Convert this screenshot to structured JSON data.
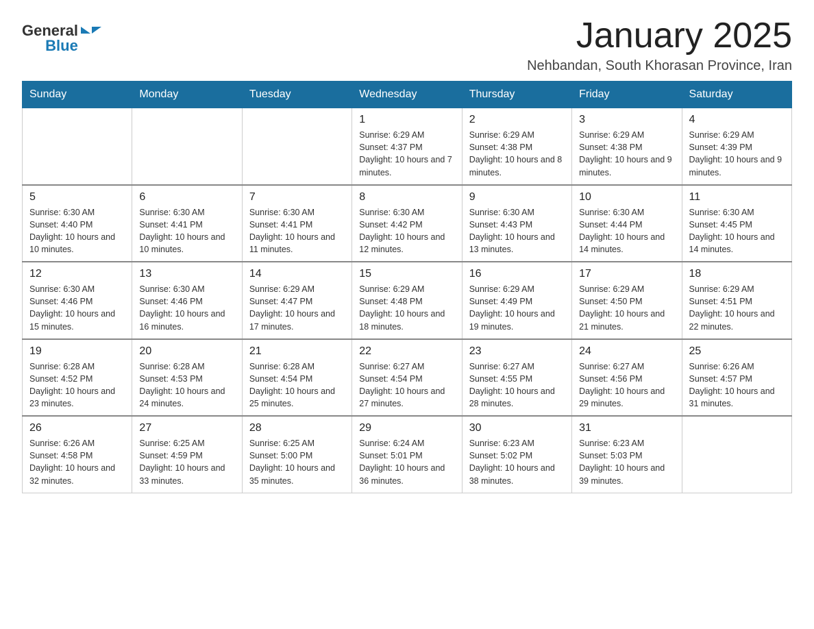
{
  "logo": {
    "general": "General",
    "blue": "Blue"
  },
  "title": "January 2025",
  "location": "Nehbandan, South Khorasan Province, Iran",
  "days_of_week": [
    "Sunday",
    "Monday",
    "Tuesday",
    "Wednesday",
    "Thursday",
    "Friday",
    "Saturday"
  ],
  "weeks": [
    [
      {
        "day": "",
        "info": ""
      },
      {
        "day": "",
        "info": ""
      },
      {
        "day": "",
        "info": ""
      },
      {
        "day": "1",
        "info": "Sunrise: 6:29 AM\nSunset: 4:37 PM\nDaylight: 10 hours and 7 minutes."
      },
      {
        "day": "2",
        "info": "Sunrise: 6:29 AM\nSunset: 4:38 PM\nDaylight: 10 hours and 8 minutes."
      },
      {
        "day": "3",
        "info": "Sunrise: 6:29 AM\nSunset: 4:38 PM\nDaylight: 10 hours and 9 minutes."
      },
      {
        "day": "4",
        "info": "Sunrise: 6:29 AM\nSunset: 4:39 PM\nDaylight: 10 hours and 9 minutes."
      }
    ],
    [
      {
        "day": "5",
        "info": "Sunrise: 6:30 AM\nSunset: 4:40 PM\nDaylight: 10 hours and 10 minutes."
      },
      {
        "day": "6",
        "info": "Sunrise: 6:30 AM\nSunset: 4:41 PM\nDaylight: 10 hours and 10 minutes."
      },
      {
        "day": "7",
        "info": "Sunrise: 6:30 AM\nSunset: 4:41 PM\nDaylight: 10 hours and 11 minutes."
      },
      {
        "day": "8",
        "info": "Sunrise: 6:30 AM\nSunset: 4:42 PM\nDaylight: 10 hours and 12 minutes."
      },
      {
        "day": "9",
        "info": "Sunrise: 6:30 AM\nSunset: 4:43 PM\nDaylight: 10 hours and 13 minutes."
      },
      {
        "day": "10",
        "info": "Sunrise: 6:30 AM\nSunset: 4:44 PM\nDaylight: 10 hours and 14 minutes."
      },
      {
        "day": "11",
        "info": "Sunrise: 6:30 AM\nSunset: 4:45 PM\nDaylight: 10 hours and 14 minutes."
      }
    ],
    [
      {
        "day": "12",
        "info": "Sunrise: 6:30 AM\nSunset: 4:46 PM\nDaylight: 10 hours and 15 minutes."
      },
      {
        "day": "13",
        "info": "Sunrise: 6:30 AM\nSunset: 4:46 PM\nDaylight: 10 hours and 16 minutes."
      },
      {
        "day": "14",
        "info": "Sunrise: 6:29 AM\nSunset: 4:47 PM\nDaylight: 10 hours and 17 minutes."
      },
      {
        "day": "15",
        "info": "Sunrise: 6:29 AM\nSunset: 4:48 PM\nDaylight: 10 hours and 18 minutes."
      },
      {
        "day": "16",
        "info": "Sunrise: 6:29 AM\nSunset: 4:49 PM\nDaylight: 10 hours and 19 minutes."
      },
      {
        "day": "17",
        "info": "Sunrise: 6:29 AM\nSunset: 4:50 PM\nDaylight: 10 hours and 21 minutes."
      },
      {
        "day": "18",
        "info": "Sunrise: 6:29 AM\nSunset: 4:51 PM\nDaylight: 10 hours and 22 minutes."
      }
    ],
    [
      {
        "day": "19",
        "info": "Sunrise: 6:28 AM\nSunset: 4:52 PM\nDaylight: 10 hours and 23 minutes."
      },
      {
        "day": "20",
        "info": "Sunrise: 6:28 AM\nSunset: 4:53 PM\nDaylight: 10 hours and 24 minutes."
      },
      {
        "day": "21",
        "info": "Sunrise: 6:28 AM\nSunset: 4:54 PM\nDaylight: 10 hours and 25 minutes."
      },
      {
        "day": "22",
        "info": "Sunrise: 6:27 AM\nSunset: 4:54 PM\nDaylight: 10 hours and 27 minutes."
      },
      {
        "day": "23",
        "info": "Sunrise: 6:27 AM\nSunset: 4:55 PM\nDaylight: 10 hours and 28 minutes."
      },
      {
        "day": "24",
        "info": "Sunrise: 6:27 AM\nSunset: 4:56 PM\nDaylight: 10 hours and 29 minutes."
      },
      {
        "day": "25",
        "info": "Sunrise: 6:26 AM\nSunset: 4:57 PM\nDaylight: 10 hours and 31 minutes."
      }
    ],
    [
      {
        "day": "26",
        "info": "Sunrise: 6:26 AM\nSunset: 4:58 PM\nDaylight: 10 hours and 32 minutes."
      },
      {
        "day": "27",
        "info": "Sunrise: 6:25 AM\nSunset: 4:59 PM\nDaylight: 10 hours and 33 minutes."
      },
      {
        "day": "28",
        "info": "Sunrise: 6:25 AM\nSunset: 5:00 PM\nDaylight: 10 hours and 35 minutes."
      },
      {
        "day": "29",
        "info": "Sunrise: 6:24 AM\nSunset: 5:01 PM\nDaylight: 10 hours and 36 minutes."
      },
      {
        "day": "30",
        "info": "Sunrise: 6:23 AM\nSunset: 5:02 PM\nDaylight: 10 hours and 38 minutes."
      },
      {
        "day": "31",
        "info": "Sunrise: 6:23 AM\nSunset: 5:03 PM\nDaylight: 10 hours and 39 minutes."
      },
      {
        "day": "",
        "info": ""
      }
    ]
  ]
}
